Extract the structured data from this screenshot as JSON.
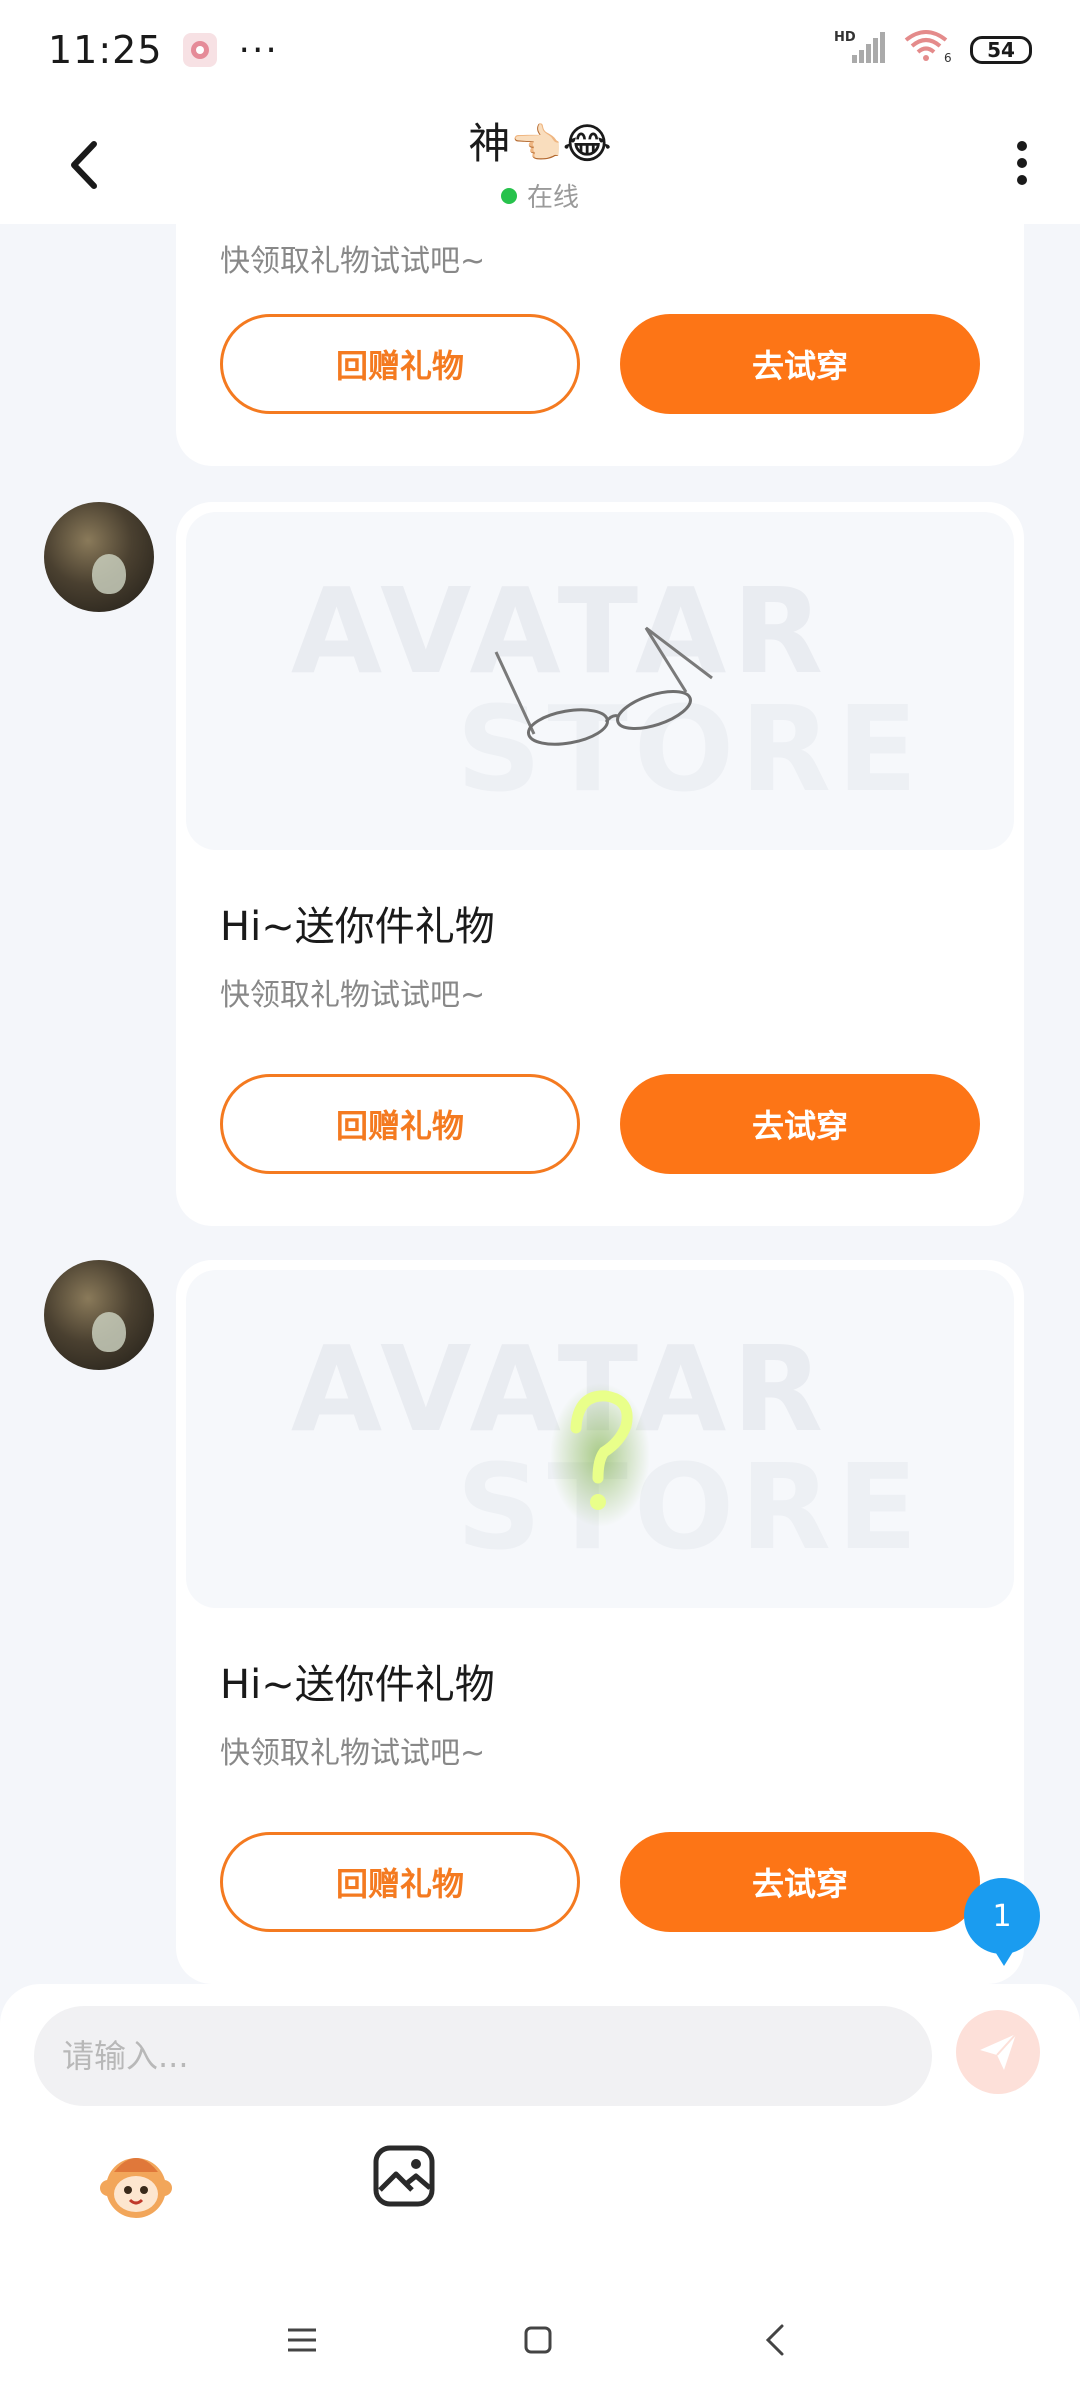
{
  "status_bar": {
    "time": "11:25",
    "more": "···",
    "network": "HD",
    "wifi_sub": "6",
    "battery": "54"
  },
  "header": {
    "title": "神👈🏻😂",
    "status": "在线"
  },
  "messages": [
    {
      "heading": "Hi~送你件礼物",
      "sub": "快领取礼物试试吧~",
      "return_gift": "回赠礼物",
      "try_on": "去试穿",
      "item_icon": "glasses-icon"
    },
    {
      "heading": "Hi~送你件礼物",
      "sub": "快领取礼物试试吧~",
      "return_gift": "回赠礼物",
      "try_on": "去试穿",
      "item_icon": "question-mark-icon"
    }
  ],
  "top_partial": {
    "sub": "快领取礼物试试吧~",
    "return_gift": "回赠礼物",
    "try_on": "去试穿"
  },
  "watermark": {
    "line1": "AVATAR",
    "line2": "STORE"
  },
  "unread_count": "1",
  "input": {
    "placeholder": "请输入..."
  },
  "colors": {
    "accent": "#fd7516",
    "online": "#27c24c",
    "badge": "#1a9cf0"
  }
}
